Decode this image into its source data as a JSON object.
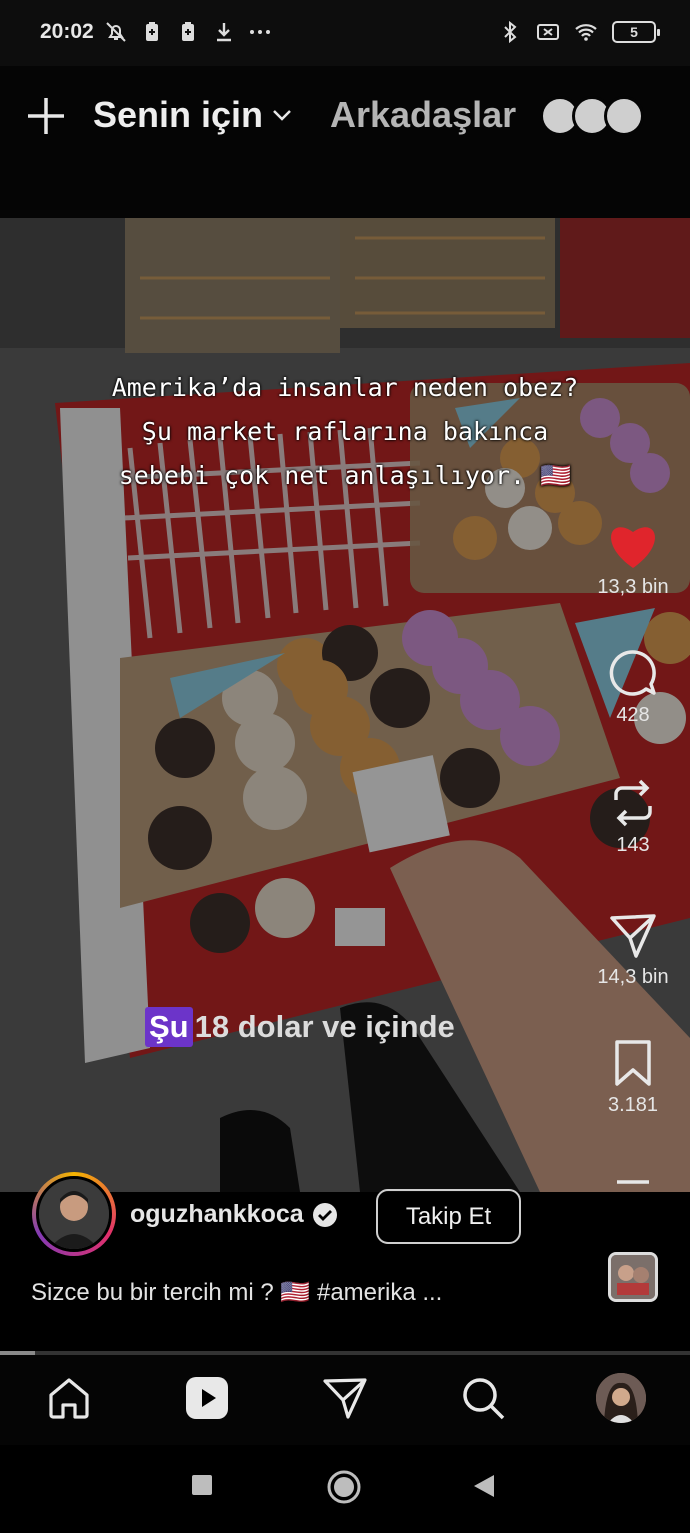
{
  "status_bar": {
    "time": "20:02",
    "left_icons": [
      "mute-bell-icon",
      "battery-saver-icon",
      "battery-saver-icon",
      "download-icon",
      "more-dots-icon"
    ],
    "right_icons": [
      "bluetooth-icon",
      "no-sim-icon",
      "wifi-icon"
    ],
    "battery_level": "5"
  },
  "top_nav": {
    "create_icon": "plus-icon",
    "tab_for_you": "Senin için",
    "tab_friends": "Arkadaşlar"
  },
  "video": {
    "caption_top": "Amerika’da insanlar neden obez? Şu market raflarına bakınca sebebi çok net anlaşılıyor. 🇺🇸",
    "caption_bottom_highlight": "Şu",
    "caption_bottom_rest": "18 dolar ve içinde"
  },
  "actions": {
    "like_count": "13,3 bin",
    "comment_count": "428",
    "repost_count": "143",
    "share_count": "14,3 bin",
    "save_count": "3.181"
  },
  "author": {
    "username": "oguzhankkoca",
    "verified_icon": "verified-badge-icon",
    "follow_label": "Takip Et",
    "caption": "Sizce bu bir tercih mi ? 🇺🇸 #amerika ..."
  },
  "playback": {
    "progress": 0.05
  },
  "bottom_nav": {
    "items": [
      "home-icon",
      "reels-icon",
      "send-icon",
      "search-icon",
      "profile-avatar"
    ]
  },
  "colors": {
    "like_red": "#e0252c",
    "highlight_purple": "#6c34c9",
    "shelf_red": "#c62a2a"
  }
}
